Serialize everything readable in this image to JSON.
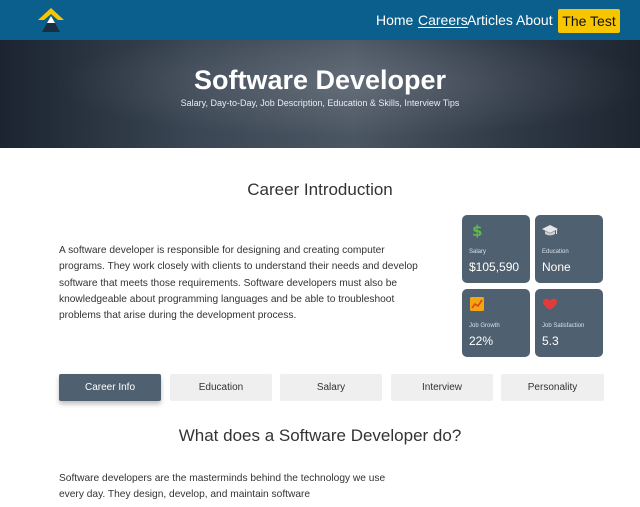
{
  "nav": {
    "items": [
      "Home",
      "Careers",
      "Articles",
      "About"
    ],
    "cta": "The Test",
    "active": "Careers",
    "brand_color": "#0b5f8c",
    "cta_color": "#f7c600"
  },
  "hero": {
    "title": "Software Developer",
    "subtitle": "Salary, Day-to-Day, Job Description, Education & Skills, Interview Tips"
  },
  "intro": {
    "title": "Career Introduction",
    "text": "A software developer is responsible for designing and creating computer programs. They work closely with clients to understand their needs and develop software that meets those requirements. Software developers must also be knowledgeable about programming languages and be able to troubleshoot problems that arise during the development process."
  },
  "stats": {
    "salary": {
      "icon": "dollar-icon",
      "label": "Salary",
      "value": "$105,590"
    },
    "education": {
      "icon": "graduation-cap-icon",
      "label": "Education",
      "value": "None"
    },
    "growth": {
      "icon": "chart-icon",
      "label": "Job Growth",
      "value": "22%"
    },
    "satisfaction": {
      "icon": "heart-icon",
      "label": "Job Satisfaction",
      "value": "5.3"
    },
    "card_color": "#4f6071"
  },
  "tabs": [
    "Career Info",
    "Education",
    "Salary",
    "Interview",
    "Personality"
  ],
  "what": {
    "title": "What does a Software Developer do?",
    "text": "Software developers are the masterminds behind the technology we use every day. They design, develop, and maintain software"
  }
}
